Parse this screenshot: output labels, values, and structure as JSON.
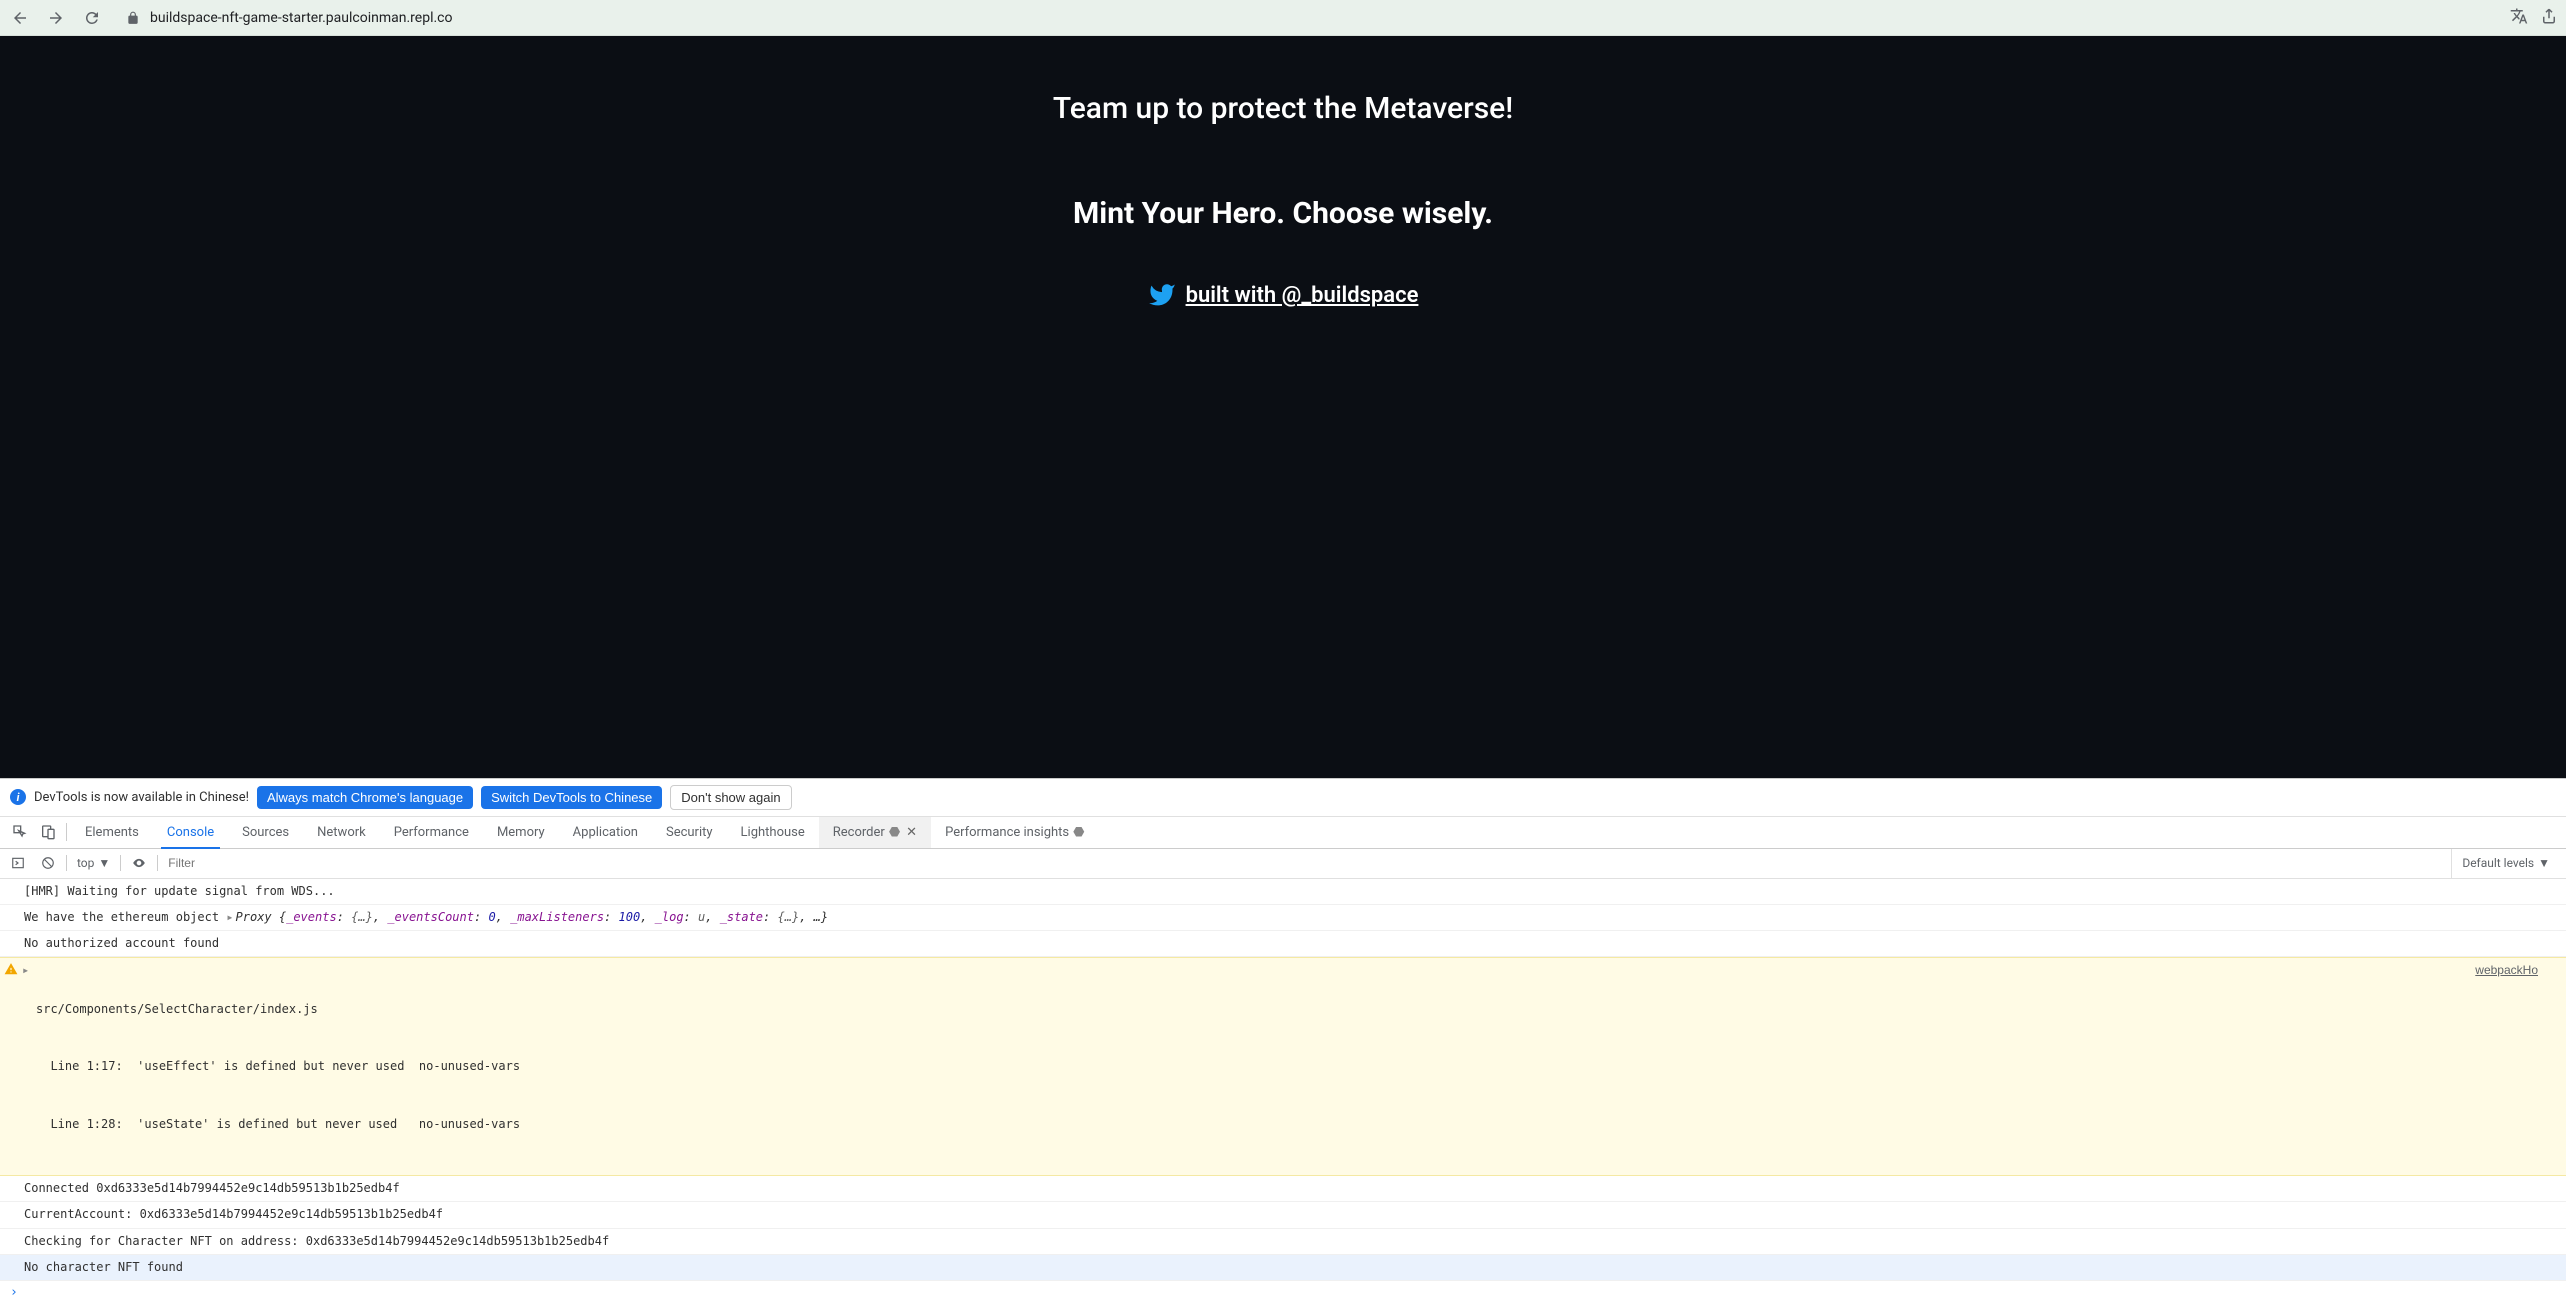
{
  "browser": {
    "url": "buildspace-nft-game-starter.paulcoinman.repl.co"
  },
  "page": {
    "subtitle": "Team up to protect the Metaverse!",
    "mint_title": "Mint Your Hero. Choose wisely.",
    "twitter_label": "built with @_buildspace"
  },
  "devtools": {
    "banner": {
      "text": "DevTools is now available in Chinese!",
      "btn1": "Always match Chrome's language",
      "btn2": "Switch DevTools to Chinese",
      "btn3": "Don't show again"
    },
    "tabs": [
      "Elements",
      "Console",
      "Sources",
      "Network",
      "Performance",
      "Memory",
      "Application",
      "Security",
      "Lighthouse",
      "Recorder",
      "Performance insights"
    ],
    "active_tab": "Console",
    "console_toolbar": {
      "context": "top",
      "filter_placeholder": "Filter",
      "levels": "Default levels"
    },
    "console": {
      "r0": "[HMR] Waiting for update signal from WDS...",
      "r1_pre": "We have the ethereum object ",
      "r1_proxy": "Proxy {_events: {…}, _eventsCount: 0, _maxListeners: 100, _log: u, _state: {…}, …}",
      "r2": "No authorized account found",
      "r3_l1": "src/Components/SelectCharacter/index.js",
      "r3_l2": "  Line 1:17:  'useEffect' is defined but never used  no-unused-vars",
      "r3_l3": "  Line 1:28:  'useState' is defined but never used   no-unused-vars",
      "r3_link": "webpackHo",
      "r4": "Connected 0xd6333e5d14b7994452e9c14db59513b1b25edb4f",
      "r5": "CurrentAccount: 0xd6333e5d14b7994452e9c14db59513b1b25edb4f",
      "r6": "Checking for Character NFT on address: 0xd6333e5d14b7994452e9c14db59513b1b25edb4f",
      "r7": "No character NFT found",
      "prompt": "›"
    }
  }
}
